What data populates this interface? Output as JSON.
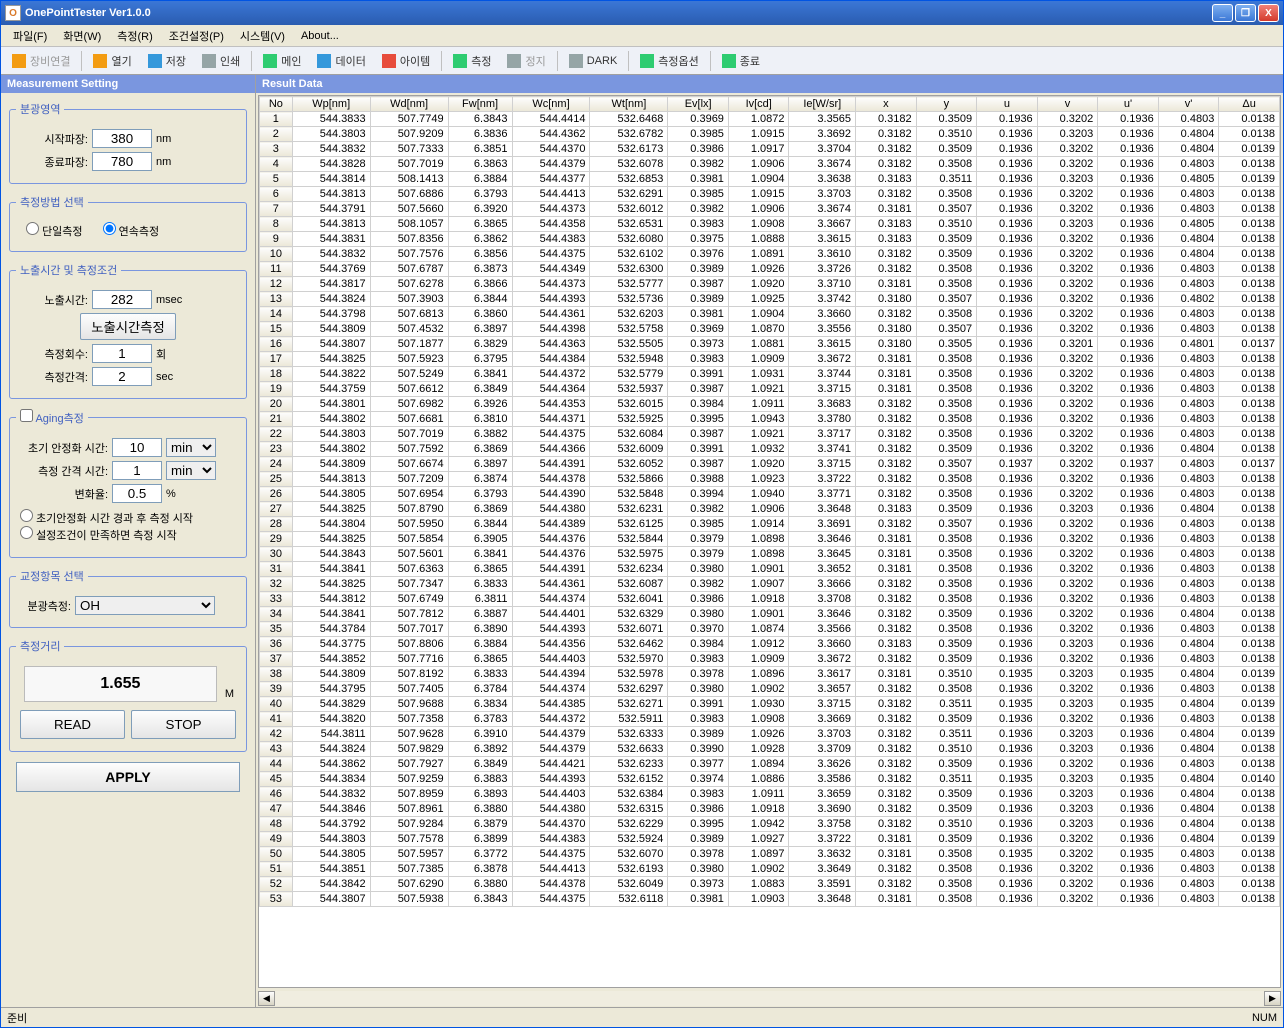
{
  "title": "OnePointTester Ver1.0.0",
  "menus": [
    "파일(F)",
    "화면(W)",
    "측정(R)",
    "조건설정(P)",
    "시스템(V)",
    "About..."
  ],
  "toolbar": [
    {
      "label": "장비연결",
      "icon": "ic-orange",
      "disabled": true
    },
    {
      "sep": true
    },
    {
      "label": "열기",
      "icon": "ic-orange"
    },
    {
      "label": "저장",
      "icon": "ic-blue"
    },
    {
      "label": "인쇄",
      "icon": "ic-gray"
    },
    {
      "sep": true
    },
    {
      "label": "메인",
      "icon": "ic-green"
    },
    {
      "label": "데이터",
      "icon": "ic-blue"
    },
    {
      "label": "아이템",
      "icon": "ic-red"
    },
    {
      "sep": true
    },
    {
      "label": "측정",
      "icon": "ic-green"
    },
    {
      "label": "정지",
      "icon": "ic-gray",
      "disabled": true
    },
    {
      "sep": true
    },
    {
      "label": "DARK",
      "icon": "ic-gray"
    },
    {
      "sep": true
    },
    {
      "label": "측정옵션",
      "icon": "ic-green"
    },
    {
      "sep": true
    },
    {
      "label": "종료",
      "icon": "ic-green"
    }
  ],
  "sidebar": {
    "header": "Measurement Setting",
    "spectral": {
      "legend": "분광영역",
      "start_label": "시작파장:",
      "start": "380",
      "end_label": "종료파장:",
      "end": "780",
      "unit": "nm"
    },
    "method": {
      "legend": "측정방법 선택",
      "single": "단일측정",
      "cont": "연속측정"
    },
    "exposure": {
      "legend": "노출시간 및 측정조건",
      "time_label": "노출시간:",
      "time": "282",
      "time_unit": "msec",
      "btn": "노출시간측정",
      "count_label": "측정회수:",
      "count": "1",
      "count_unit": "회",
      "interval_label": "측정간격:",
      "interval": "2",
      "interval_unit": "sec"
    },
    "aging": {
      "checkbox": "Aging측정",
      "init_label": "초기 안정화 시간:",
      "init": "10",
      "init_unit": "min",
      "interval_label": "측정 간격 시간:",
      "interval": "1",
      "interval_unit": "min",
      "rate_label": "변화율:",
      "rate": "0.5",
      "rate_unit": "%",
      "opt1": "초기안정화 시간 경과 후 측정 시작",
      "opt2": "설정조건이 만족하면 측정 시작"
    },
    "calib": {
      "legend": "교정항목 선택",
      "label": "분광측정:",
      "value": "OH"
    },
    "distance": {
      "legend": "측정거리",
      "value": "1.655",
      "unit": "M",
      "read": "READ",
      "stop": "STOP"
    },
    "apply": "APPLY"
  },
  "result": {
    "header": "Result Data",
    "columns": [
      "No",
      "Wp[nm]",
      "Wd[nm]",
      "Fw[nm]",
      "Wc[nm]",
      "Wt[nm]",
      "Ev[lx]",
      "Iv[cd]",
      "Ie[W/sr]",
      "x",
      "y",
      "u",
      "v",
      "u'",
      "v'",
      "Δu"
    ],
    "rows": [
      [
        1,
        "544.3833",
        "507.7749",
        "6.3843",
        "544.4414",
        "532.6468",
        "0.3969",
        "1.0872",
        "3.3565",
        "0.3182",
        "0.3509",
        "0.1936",
        "0.3202",
        "0.1936",
        "0.4803",
        "0.0138"
      ],
      [
        2,
        "544.3803",
        "507.9209",
        "6.3836",
        "544.4362",
        "532.6782",
        "0.3985",
        "1.0915",
        "3.3692",
        "0.3182",
        "0.3510",
        "0.1936",
        "0.3203",
        "0.1936",
        "0.4804",
        "0.0138"
      ],
      [
        3,
        "544.3832",
        "507.7333",
        "6.3851",
        "544.4370",
        "532.6173",
        "0.3986",
        "1.0917",
        "3.3704",
        "0.3182",
        "0.3509",
        "0.1936",
        "0.3202",
        "0.1936",
        "0.4804",
        "0.0139"
      ],
      [
        4,
        "544.3828",
        "507.7019",
        "6.3863",
        "544.4379",
        "532.6078",
        "0.3982",
        "1.0906",
        "3.3674",
        "0.3182",
        "0.3508",
        "0.1936",
        "0.3202",
        "0.1936",
        "0.4803",
        "0.0138"
      ],
      [
        5,
        "544.3814",
        "508.1413",
        "6.3884",
        "544.4377",
        "532.6853",
        "0.3981",
        "1.0904",
        "3.3638",
        "0.3183",
        "0.3511",
        "0.1936",
        "0.3203",
        "0.1936",
        "0.4805",
        "0.0139"
      ],
      [
        6,
        "544.3813",
        "507.6886",
        "6.3793",
        "544.4413",
        "532.6291",
        "0.3985",
        "1.0915",
        "3.3703",
        "0.3182",
        "0.3508",
        "0.1936",
        "0.3202",
        "0.1936",
        "0.4803",
        "0.0138"
      ],
      [
        7,
        "544.3791",
        "507.5660",
        "6.3920",
        "544.4373",
        "532.6012",
        "0.3982",
        "1.0906",
        "3.3674",
        "0.3181",
        "0.3507",
        "0.1936",
        "0.3202",
        "0.1936",
        "0.4803",
        "0.0138"
      ],
      [
        8,
        "544.3813",
        "508.1057",
        "6.3865",
        "544.4358",
        "532.6531",
        "0.3983",
        "1.0908",
        "3.3667",
        "0.3183",
        "0.3510",
        "0.1936",
        "0.3203",
        "0.1936",
        "0.4805",
        "0.0138"
      ],
      [
        9,
        "544.3831",
        "507.8356",
        "6.3862",
        "544.4383",
        "532.6080",
        "0.3975",
        "1.0888",
        "3.3615",
        "0.3183",
        "0.3509",
        "0.1936",
        "0.3202",
        "0.1936",
        "0.4804",
        "0.0138"
      ],
      [
        10,
        "544.3832",
        "507.7576",
        "6.3856",
        "544.4375",
        "532.6102",
        "0.3976",
        "1.0891",
        "3.3610",
        "0.3182",
        "0.3509",
        "0.1936",
        "0.3202",
        "0.1936",
        "0.4804",
        "0.0138"
      ],
      [
        11,
        "544.3769",
        "507.6787",
        "6.3873",
        "544.4349",
        "532.6300",
        "0.3989",
        "1.0926",
        "3.3726",
        "0.3182",
        "0.3508",
        "0.1936",
        "0.3202",
        "0.1936",
        "0.4803",
        "0.0138"
      ],
      [
        12,
        "544.3817",
        "507.6278",
        "6.3866",
        "544.4373",
        "532.5777",
        "0.3987",
        "1.0920",
        "3.3710",
        "0.3181",
        "0.3508",
        "0.1936",
        "0.3202",
        "0.1936",
        "0.4803",
        "0.0138"
      ],
      [
        13,
        "544.3824",
        "507.3903",
        "6.3844",
        "544.4393",
        "532.5736",
        "0.3989",
        "1.0925",
        "3.3742",
        "0.3180",
        "0.3507",
        "0.1936",
        "0.3202",
        "0.1936",
        "0.4802",
        "0.0138"
      ],
      [
        14,
        "544.3798",
        "507.6813",
        "6.3860",
        "544.4361",
        "532.6203",
        "0.3981",
        "1.0904",
        "3.3660",
        "0.3182",
        "0.3508",
        "0.1936",
        "0.3202",
        "0.1936",
        "0.4803",
        "0.0138"
      ],
      [
        15,
        "544.3809",
        "507.4532",
        "6.3897",
        "544.4398",
        "532.5758",
        "0.3969",
        "1.0870",
        "3.3556",
        "0.3180",
        "0.3507",
        "0.1936",
        "0.3202",
        "0.1936",
        "0.4803",
        "0.0138"
      ],
      [
        16,
        "544.3807",
        "507.1877",
        "6.3829",
        "544.4363",
        "532.5505",
        "0.3973",
        "1.0881",
        "3.3615",
        "0.3180",
        "0.3505",
        "0.1936",
        "0.3201",
        "0.1936",
        "0.4801",
        "0.0137"
      ],
      [
        17,
        "544.3825",
        "507.5923",
        "6.3795",
        "544.4384",
        "532.5948",
        "0.3983",
        "1.0909",
        "3.3672",
        "0.3181",
        "0.3508",
        "0.1936",
        "0.3202",
        "0.1936",
        "0.4803",
        "0.0138"
      ],
      [
        18,
        "544.3822",
        "507.5249",
        "6.3841",
        "544.4372",
        "532.5779",
        "0.3991",
        "1.0931",
        "3.3744",
        "0.3181",
        "0.3508",
        "0.1936",
        "0.3202",
        "0.1936",
        "0.4803",
        "0.0138"
      ],
      [
        19,
        "544.3759",
        "507.6612",
        "6.3849",
        "544.4364",
        "532.5937",
        "0.3987",
        "1.0921",
        "3.3715",
        "0.3181",
        "0.3508",
        "0.1936",
        "0.3202",
        "0.1936",
        "0.4803",
        "0.0138"
      ],
      [
        20,
        "544.3801",
        "507.6982",
        "6.3926",
        "544.4353",
        "532.6015",
        "0.3984",
        "1.0911",
        "3.3683",
        "0.3182",
        "0.3508",
        "0.1936",
        "0.3202",
        "0.1936",
        "0.4803",
        "0.0138"
      ],
      [
        21,
        "544.3802",
        "507.6681",
        "6.3810",
        "544.4371",
        "532.5925",
        "0.3995",
        "1.0943",
        "3.3780",
        "0.3182",
        "0.3508",
        "0.1936",
        "0.3202",
        "0.1936",
        "0.4803",
        "0.0138"
      ],
      [
        22,
        "544.3803",
        "507.7019",
        "6.3882",
        "544.4375",
        "532.6084",
        "0.3987",
        "1.0921",
        "3.3717",
        "0.3182",
        "0.3508",
        "0.1936",
        "0.3202",
        "0.1936",
        "0.4803",
        "0.0138"
      ],
      [
        23,
        "544.3802",
        "507.7592",
        "6.3869",
        "544.4366",
        "532.6009",
        "0.3991",
        "1.0932",
        "3.3741",
        "0.3182",
        "0.3509",
        "0.1936",
        "0.3202",
        "0.1936",
        "0.4804",
        "0.0138"
      ],
      [
        24,
        "544.3809",
        "507.6674",
        "6.3897",
        "544.4391",
        "532.6052",
        "0.3987",
        "1.0920",
        "3.3715",
        "0.3182",
        "0.3507",
        "0.1937",
        "0.3202",
        "0.1937",
        "0.4803",
        "0.0137"
      ],
      [
        25,
        "544.3813",
        "507.7209",
        "6.3874",
        "544.4378",
        "532.5866",
        "0.3988",
        "1.0923",
        "3.3722",
        "0.3182",
        "0.3508",
        "0.1936",
        "0.3202",
        "0.1936",
        "0.4803",
        "0.0138"
      ],
      [
        26,
        "544.3805",
        "507.6954",
        "6.3793",
        "544.4390",
        "532.5848",
        "0.3994",
        "1.0940",
        "3.3771",
        "0.3182",
        "0.3508",
        "0.1936",
        "0.3202",
        "0.1936",
        "0.4803",
        "0.0138"
      ],
      [
        27,
        "544.3825",
        "507.8790",
        "6.3869",
        "544.4380",
        "532.6231",
        "0.3982",
        "1.0906",
        "3.3648",
        "0.3183",
        "0.3509",
        "0.1936",
        "0.3203",
        "0.1936",
        "0.4804",
        "0.0138"
      ],
      [
        28,
        "544.3804",
        "507.5950",
        "6.3844",
        "544.4389",
        "532.6125",
        "0.3985",
        "1.0914",
        "3.3691",
        "0.3182",
        "0.3507",
        "0.1936",
        "0.3202",
        "0.1936",
        "0.4803",
        "0.0138"
      ],
      [
        29,
        "544.3825",
        "507.5854",
        "6.3905",
        "544.4376",
        "532.5844",
        "0.3979",
        "1.0898",
        "3.3646",
        "0.3181",
        "0.3508",
        "0.1936",
        "0.3202",
        "0.1936",
        "0.4803",
        "0.0138"
      ],
      [
        30,
        "544.3843",
        "507.5601",
        "6.3841",
        "544.4376",
        "532.5975",
        "0.3979",
        "1.0898",
        "3.3645",
        "0.3181",
        "0.3508",
        "0.1936",
        "0.3202",
        "0.1936",
        "0.4803",
        "0.0138"
      ],
      [
        31,
        "544.3841",
        "507.6363",
        "6.3865",
        "544.4391",
        "532.6234",
        "0.3980",
        "1.0901",
        "3.3652",
        "0.3181",
        "0.3508",
        "0.1936",
        "0.3202",
        "0.1936",
        "0.4803",
        "0.0138"
      ],
      [
        32,
        "544.3825",
        "507.7347",
        "6.3833",
        "544.4361",
        "532.6087",
        "0.3982",
        "1.0907",
        "3.3666",
        "0.3182",
        "0.3508",
        "0.1936",
        "0.3202",
        "0.1936",
        "0.4803",
        "0.0138"
      ],
      [
        33,
        "544.3812",
        "507.6749",
        "6.3811",
        "544.4374",
        "532.6041",
        "0.3986",
        "1.0918",
        "3.3708",
        "0.3182",
        "0.3508",
        "0.1936",
        "0.3202",
        "0.1936",
        "0.4803",
        "0.0138"
      ],
      [
        34,
        "544.3841",
        "507.7812",
        "6.3887",
        "544.4401",
        "532.6329",
        "0.3980",
        "1.0901",
        "3.3646",
        "0.3182",
        "0.3509",
        "0.1936",
        "0.3202",
        "0.1936",
        "0.4804",
        "0.0138"
      ],
      [
        35,
        "544.3784",
        "507.7017",
        "6.3890",
        "544.4393",
        "532.6071",
        "0.3970",
        "1.0874",
        "3.3566",
        "0.3182",
        "0.3508",
        "0.1936",
        "0.3202",
        "0.1936",
        "0.4803",
        "0.0138"
      ],
      [
        36,
        "544.3775",
        "507.8806",
        "6.3884",
        "544.4356",
        "532.6462",
        "0.3984",
        "1.0912",
        "3.3660",
        "0.3183",
        "0.3509",
        "0.1936",
        "0.3203",
        "0.1936",
        "0.4804",
        "0.0138"
      ],
      [
        37,
        "544.3852",
        "507.7716",
        "6.3865",
        "544.4403",
        "532.5970",
        "0.3983",
        "1.0909",
        "3.3672",
        "0.3182",
        "0.3509",
        "0.1936",
        "0.3202",
        "0.1936",
        "0.4803",
        "0.0138"
      ],
      [
        38,
        "544.3809",
        "507.8192",
        "6.3833",
        "544.4394",
        "532.5978",
        "0.3978",
        "1.0896",
        "3.3617",
        "0.3181",
        "0.3510",
        "0.1935",
        "0.3203",
        "0.1935",
        "0.4804",
        "0.0139"
      ],
      [
        39,
        "544.3795",
        "507.7405",
        "6.3784",
        "544.4374",
        "532.6297",
        "0.3980",
        "1.0902",
        "3.3657",
        "0.3182",
        "0.3508",
        "0.1936",
        "0.3202",
        "0.1936",
        "0.4803",
        "0.0138"
      ],
      [
        40,
        "544.3829",
        "507.9688",
        "6.3834",
        "544.4385",
        "532.6271",
        "0.3991",
        "1.0930",
        "3.3715",
        "0.3182",
        "0.3511",
        "0.1935",
        "0.3203",
        "0.1935",
        "0.4804",
        "0.0139"
      ],
      [
        41,
        "544.3820",
        "507.7358",
        "6.3783",
        "544.4372",
        "532.5911",
        "0.3983",
        "1.0908",
        "3.3669",
        "0.3182",
        "0.3509",
        "0.1936",
        "0.3202",
        "0.1936",
        "0.4803",
        "0.0138"
      ],
      [
        42,
        "544.3811",
        "507.9628",
        "6.3910",
        "544.4379",
        "532.6333",
        "0.3989",
        "1.0926",
        "3.3703",
        "0.3182",
        "0.3511",
        "0.1936",
        "0.3203",
        "0.1936",
        "0.4804",
        "0.0139"
      ],
      [
        43,
        "544.3824",
        "507.9829",
        "6.3892",
        "544.4379",
        "532.6633",
        "0.3990",
        "1.0928",
        "3.3709",
        "0.3182",
        "0.3510",
        "0.1936",
        "0.3203",
        "0.1936",
        "0.4804",
        "0.0138"
      ],
      [
        44,
        "544.3862",
        "507.7927",
        "6.3849",
        "544.4421",
        "532.6233",
        "0.3977",
        "1.0894",
        "3.3626",
        "0.3182",
        "0.3509",
        "0.1936",
        "0.3202",
        "0.1936",
        "0.4803",
        "0.0138"
      ],
      [
        45,
        "544.3834",
        "507.9259",
        "6.3883",
        "544.4393",
        "532.6152",
        "0.3974",
        "1.0886",
        "3.3586",
        "0.3182",
        "0.3511",
        "0.1935",
        "0.3203",
        "0.1935",
        "0.4804",
        "0.0140"
      ],
      [
        46,
        "544.3832",
        "507.8959",
        "6.3893",
        "544.4403",
        "532.6384",
        "0.3983",
        "1.0911",
        "3.3659",
        "0.3182",
        "0.3509",
        "0.1936",
        "0.3203",
        "0.1936",
        "0.4804",
        "0.0138"
      ],
      [
        47,
        "544.3846",
        "507.8961",
        "6.3880",
        "544.4380",
        "532.6315",
        "0.3986",
        "1.0918",
        "3.3690",
        "0.3182",
        "0.3509",
        "0.1936",
        "0.3203",
        "0.1936",
        "0.4804",
        "0.0138"
      ],
      [
        48,
        "544.3792",
        "507.9284",
        "6.3879",
        "544.4370",
        "532.6229",
        "0.3995",
        "1.0942",
        "3.3758",
        "0.3182",
        "0.3510",
        "0.1936",
        "0.3203",
        "0.1936",
        "0.4804",
        "0.0138"
      ],
      [
        49,
        "544.3803",
        "507.7578",
        "6.3899",
        "544.4383",
        "532.5924",
        "0.3989",
        "1.0927",
        "3.3722",
        "0.3181",
        "0.3509",
        "0.1936",
        "0.3202",
        "0.1936",
        "0.4804",
        "0.0139"
      ],
      [
        50,
        "544.3805",
        "507.5957",
        "6.3772",
        "544.4375",
        "532.6070",
        "0.3978",
        "1.0897",
        "3.3632",
        "0.3181",
        "0.3508",
        "0.1935",
        "0.3202",
        "0.1935",
        "0.4803",
        "0.0138"
      ],
      [
        51,
        "544.3851",
        "507.7385",
        "6.3878",
        "544.4413",
        "532.6193",
        "0.3980",
        "1.0902",
        "3.3649",
        "0.3182",
        "0.3508",
        "0.1936",
        "0.3202",
        "0.1936",
        "0.4803",
        "0.0138"
      ],
      [
        52,
        "544.3842",
        "507.6290",
        "6.3880",
        "544.4378",
        "532.6049",
        "0.3973",
        "1.0883",
        "3.3591",
        "0.3182",
        "0.3508",
        "0.1936",
        "0.3202",
        "0.1936",
        "0.4803",
        "0.0138"
      ],
      [
        53,
        "544.3807",
        "507.5938",
        "6.3843",
        "544.4375",
        "532.6118",
        "0.3981",
        "1.0903",
        "3.3648",
        "0.3181",
        "0.3508",
        "0.1936",
        "0.3202",
        "0.1936",
        "0.4803",
        "0.0138"
      ]
    ]
  },
  "status": {
    "left": "준비",
    "right": "NUM"
  }
}
